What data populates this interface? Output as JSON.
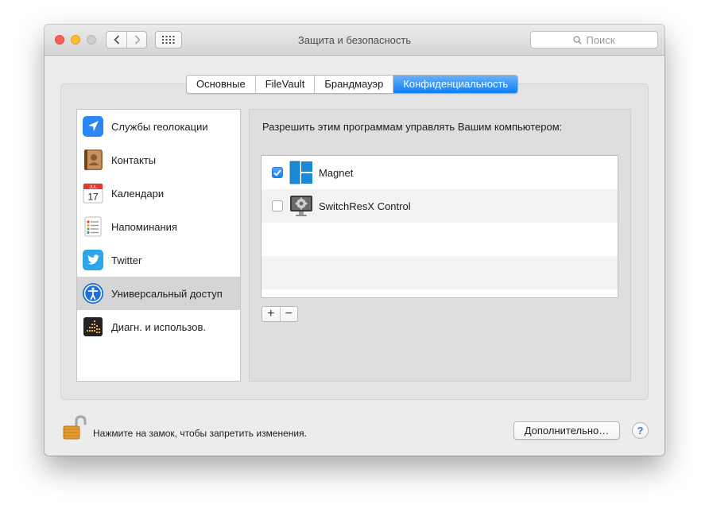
{
  "window": {
    "title": "Защита и безопасность",
    "search_placeholder": "Поиск"
  },
  "tabs": [
    {
      "label": "Основные",
      "active": false
    },
    {
      "label": "FileVault",
      "active": false
    },
    {
      "label": "Брандмауэр",
      "active": false
    },
    {
      "label": "Конфиденциальность",
      "active": true
    }
  ],
  "sidebar": {
    "items": [
      {
        "label": "Службы геолокации",
        "icon": "location-arrow-icon",
        "selected": false
      },
      {
        "label": "Контакты",
        "icon": "contacts-book-icon",
        "selected": false
      },
      {
        "label": "Календари",
        "icon": "calendar-icon",
        "selected": false
      },
      {
        "label": "Напоминания",
        "icon": "reminders-icon",
        "selected": false
      },
      {
        "label": "Twitter",
        "icon": "twitter-bird-icon",
        "selected": false
      },
      {
        "label": "Универсальный доступ",
        "icon": "accessibility-icon",
        "selected": true
      },
      {
        "label": "Диагн. и использов.",
        "icon": "diagnostics-icon",
        "selected": false
      }
    ],
    "calendar_icon_month": "JUL",
    "calendar_icon_day": "17"
  },
  "main": {
    "header": "Разрешить этим программам управлять Вашим компьютером:",
    "apps": [
      {
        "name": "Magnet",
        "checked": true,
        "icon": "magnet-app-icon"
      },
      {
        "name": "SwitchResX Control",
        "checked": false,
        "icon": "switchresx-app-icon"
      }
    ],
    "add_label": "+",
    "remove_label": "−"
  },
  "footer": {
    "lock_text": "Нажмите на замок, чтобы запретить изменения.",
    "advanced_button": "Дополнительно…",
    "help_label": "?"
  },
  "colors": {
    "accent": "#1a80f4",
    "selected_row": "#d5d5d5",
    "pane_bg": "#e3e3e3"
  }
}
